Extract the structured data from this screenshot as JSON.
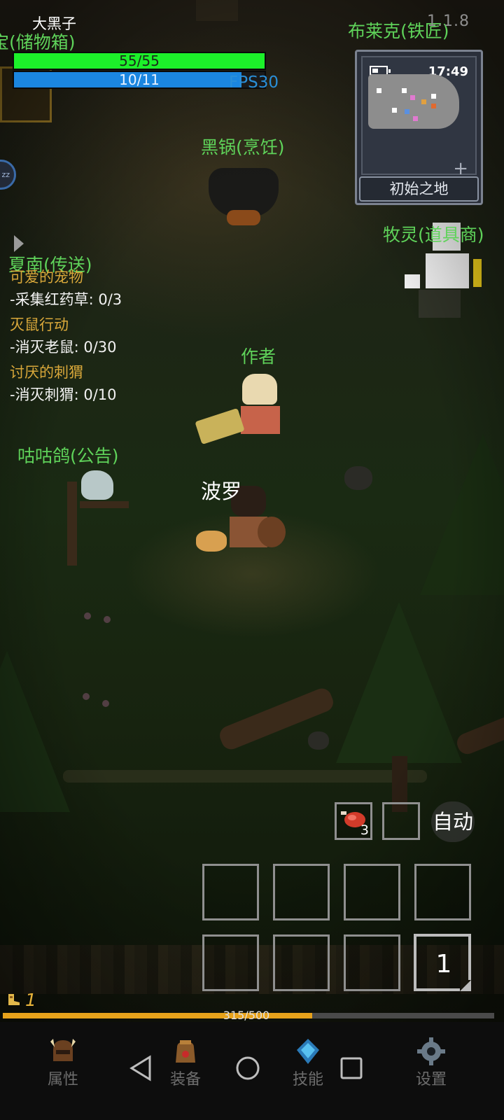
{
  "player": {
    "name": "大黑子",
    "hp": "55/55",
    "hp_fraction": 1.0,
    "mp": "10/11",
    "mp_fraction": 0.909,
    "level": "1",
    "xp": "315/500",
    "xp_fraction": 0.63
  },
  "hud": {
    "fps": "FPS30",
    "version": "1.1.8"
  },
  "minimap": {
    "time": "17:49",
    "area": "初始之地"
  },
  "npcs": {
    "storage": "宝(储物箱)",
    "blacksmith": "布莱克(铁匠)",
    "cooking": "黑锅(烹饪)",
    "merchant": "牧灵(道具商)",
    "teleport": "夏南(传送)",
    "author": "作者",
    "announcement": "咕咕鸽(公告)"
  },
  "other_players": {
    "bolo": "波罗"
  },
  "quests": [
    {
      "title": "可爱的宠物",
      "objective": "-采集红药草: 0/3"
    },
    {
      "title": "灭鼠行动",
      "objective": "-消灭老鼠: 0/30"
    },
    {
      "title": "讨厌的刺猬",
      "objective": "-消灭刺猬: 0/10"
    }
  ],
  "action_bar": {
    "potion_count": "3",
    "auto_label": "自动",
    "page": "1"
  },
  "tabs": [
    {
      "label": "属性",
      "icon": "helmet-icon"
    },
    {
      "label": "装备",
      "icon": "bag-icon"
    },
    {
      "label": "技能",
      "icon": "gem-icon"
    },
    {
      "label": "设置",
      "icon": "gear-icon"
    }
  ],
  "sleep_badge": "zz",
  "colors": {
    "npc_name": "#5fd35a",
    "quest_title": "#d9a83a",
    "hp": "#1cf02a",
    "mp": "#1b86e0",
    "xp": "#e7a21b"
  }
}
